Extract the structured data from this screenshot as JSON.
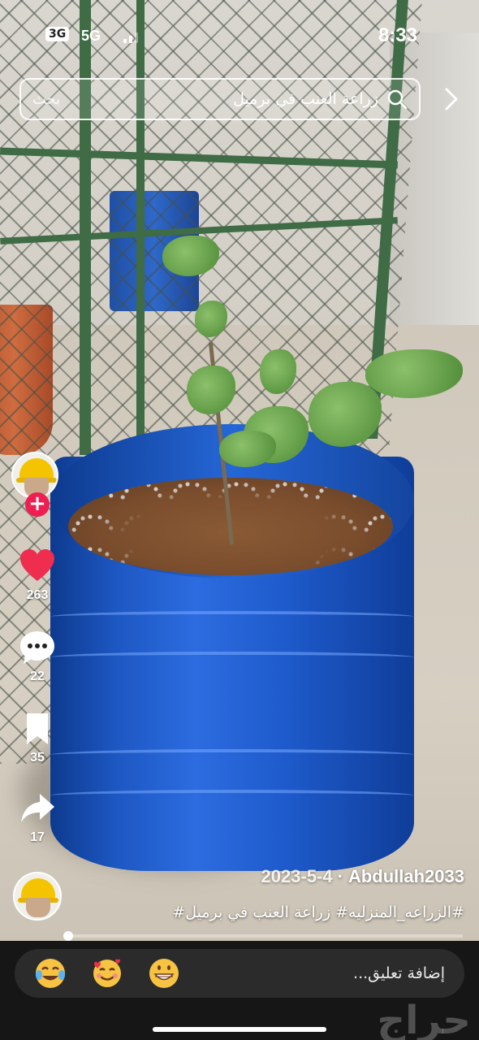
{
  "status_bar": {
    "time": "8:33",
    "signal_badge": "3G",
    "network": "5G"
  },
  "search": {
    "query": "زراعة العنب في برميل",
    "button_label": "بحث"
  },
  "creator": {
    "username": "Abdullah2033",
    "date": "2023-5-4",
    "separator": "·"
  },
  "caption": "#الزراعه_المنزليه# زراعة العنب في برميل#",
  "actions": {
    "likes": "263",
    "comments": "22",
    "bookmarks": "35",
    "shares": "17"
  },
  "progress": {
    "fraction": 0.0
  },
  "comment_bar": {
    "placeholder": "إضافة تعليق...",
    "emojis": [
      "face-with-tears-of-joy",
      "smiling-face-with-hearts",
      "grinning-face"
    ]
  },
  "watermark": "حراج",
  "colors": {
    "like": "#ee2d4f",
    "follow": "#ee1d52",
    "barrel": "#1e5acb"
  }
}
